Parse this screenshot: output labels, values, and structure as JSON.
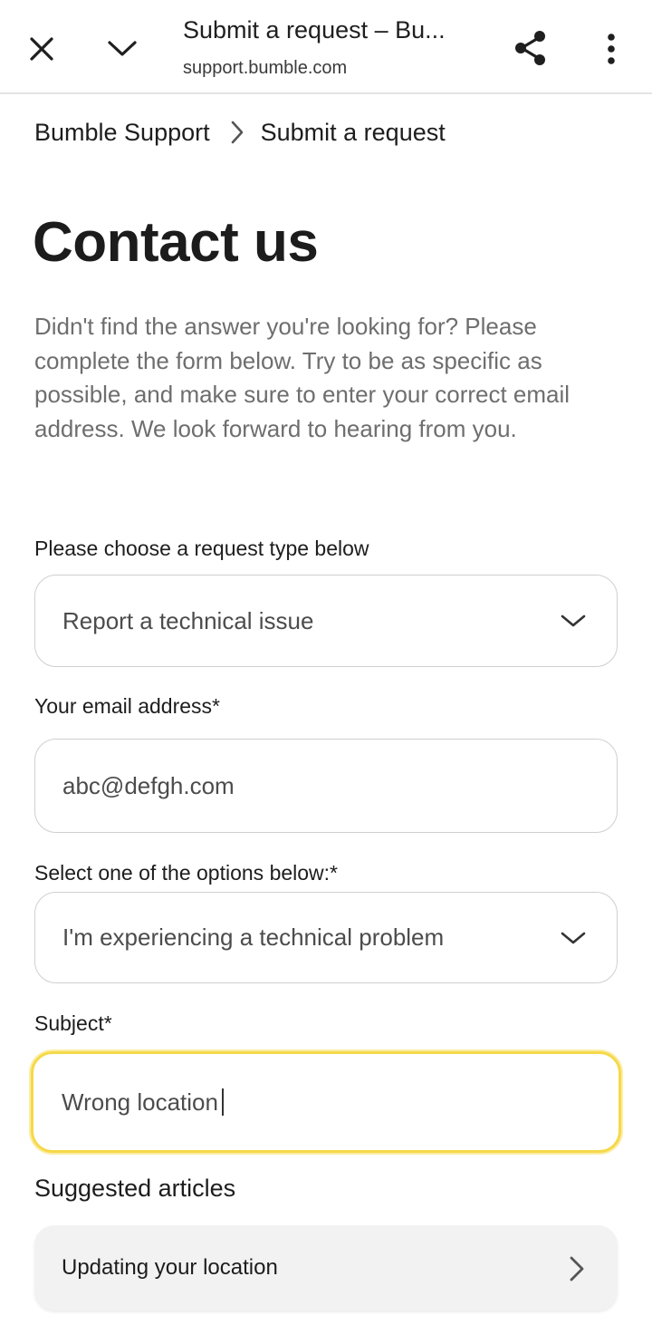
{
  "browser": {
    "tab_title": "Submit a request – Bu...",
    "url": "support.bumble.com",
    "icons": [
      "close-icon",
      "chevron-down-icon",
      "share-icon",
      "more-vert-icon"
    ]
  },
  "breadcrumb": {
    "items": [
      "Bumble Support",
      "Submit a request"
    ]
  },
  "page": {
    "title": "Contact us",
    "intro": "Didn't find the answer you're looking for? Please complete the form below. Try to be as specific as possible, and make sure to enter your correct email address. We look forward to hearing from you."
  },
  "form": {
    "request_type": {
      "label": "Please choose a request type below",
      "value": "Report a technical issue"
    },
    "email": {
      "label": "Your email address*",
      "value": "abc@defgh.com"
    },
    "option": {
      "label": "Select one of the options below:*",
      "value": "I'm experiencing a technical problem"
    },
    "subject": {
      "label": "Subject*",
      "value": "Wrong location"
    }
  },
  "suggested": {
    "title": "Suggested articles",
    "articles": [
      "Updating your location"
    ]
  },
  "colors": {
    "focus_border": "#f5d94a",
    "text": "#1d1d1d",
    "muted_text": "#6e6e6e",
    "field_border": "#cfcfcf",
    "article_bg": "#f2f2f2"
  }
}
